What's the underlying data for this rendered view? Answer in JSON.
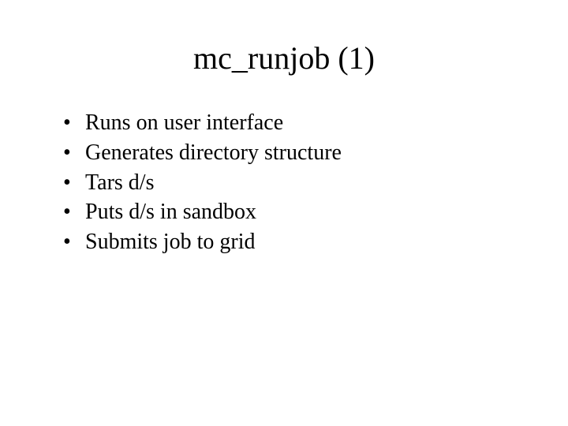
{
  "slide": {
    "title": "mc_runjob (1)",
    "bullets": [
      "Runs on user interface",
      "Generates directory structure",
      "Tars d/s",
      "Puts d/s in sandbox",
      "Submits job to grid"
    ]
  }
}
